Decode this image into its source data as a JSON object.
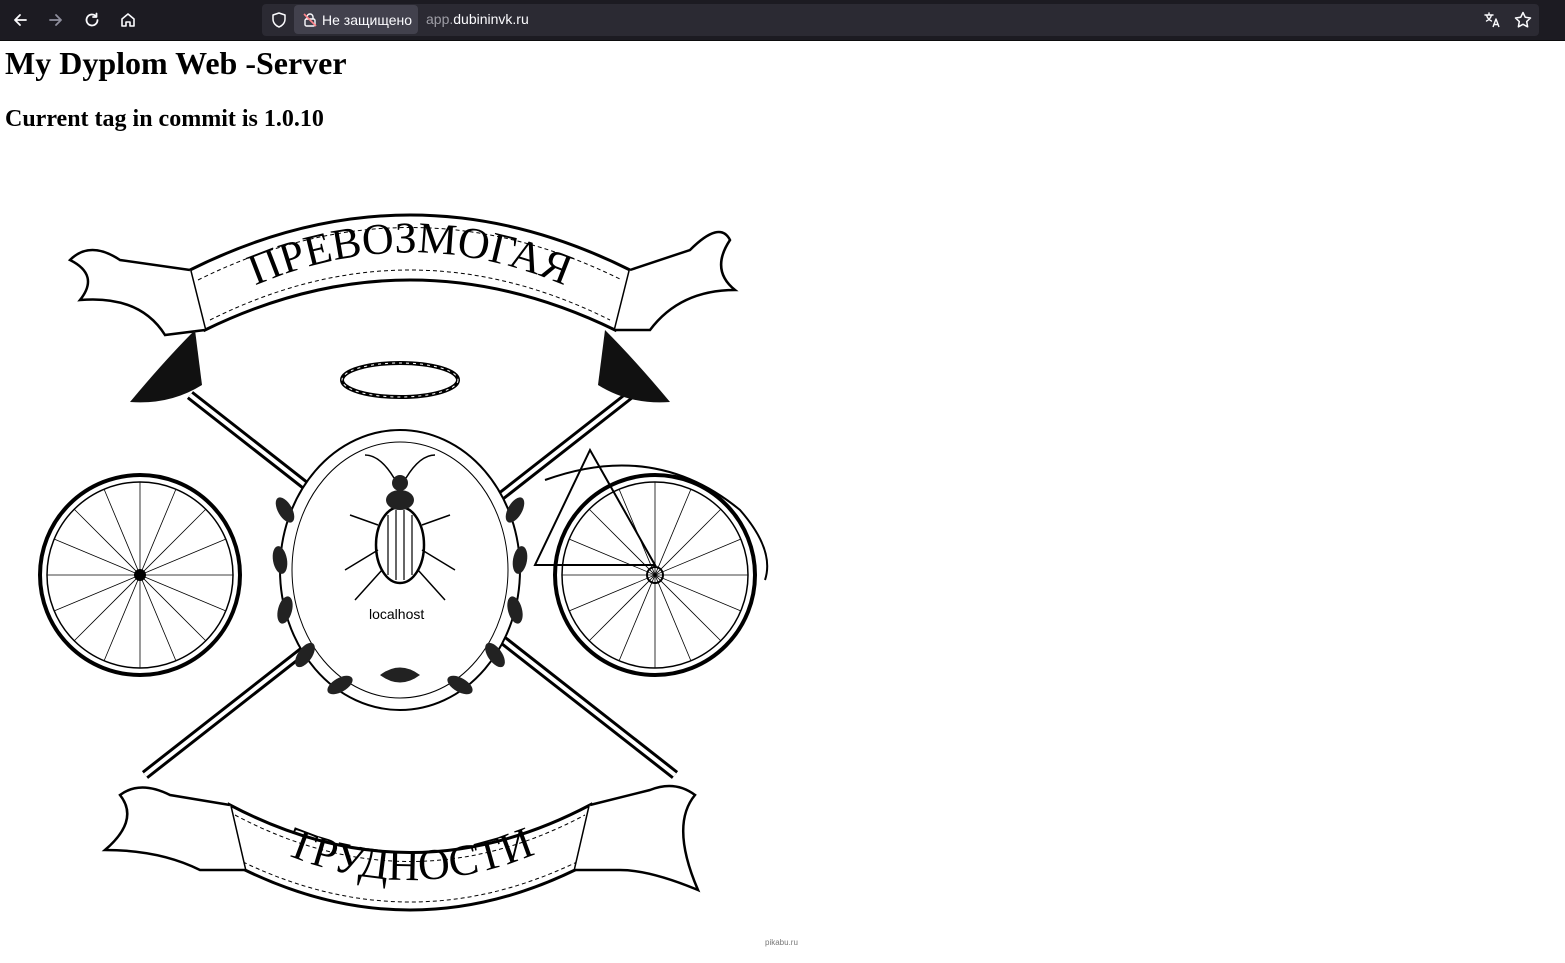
{
  "browser": {
    "security_label": "Не защищено",
    "url_prefix": "app.",
    "url_domain": "dubininvk.ru",
    "icons": [
      "back-icon",
      "forward-icon",
      "reload-icon",
      "home-icon",
      "shield-icon",
      "insecure-lock-icon",
      "translate-icon",
      "bookmark-star-icon"
    ]
  },
  "page": {
    "title": "My Dyplom Web -Server",
    "subtitle": "Current tag in commit is 1.0.10"
  },
  "emblem": {
    "top_banner": "ПРЕВОЗМОГАЯ",
    "bottom_banner": "ТРУДНОСТИ",
    "center_caption": "localhost",
    "watermark": "pikabu.ru"
  },
  "colors": {
    "toolbar_bg": "#1c1b22",
    "urlbar_bg": "#2b2a33",
    "pill_bg": "#42414d",
    "page_bg": "#ffffff"
  }
}
